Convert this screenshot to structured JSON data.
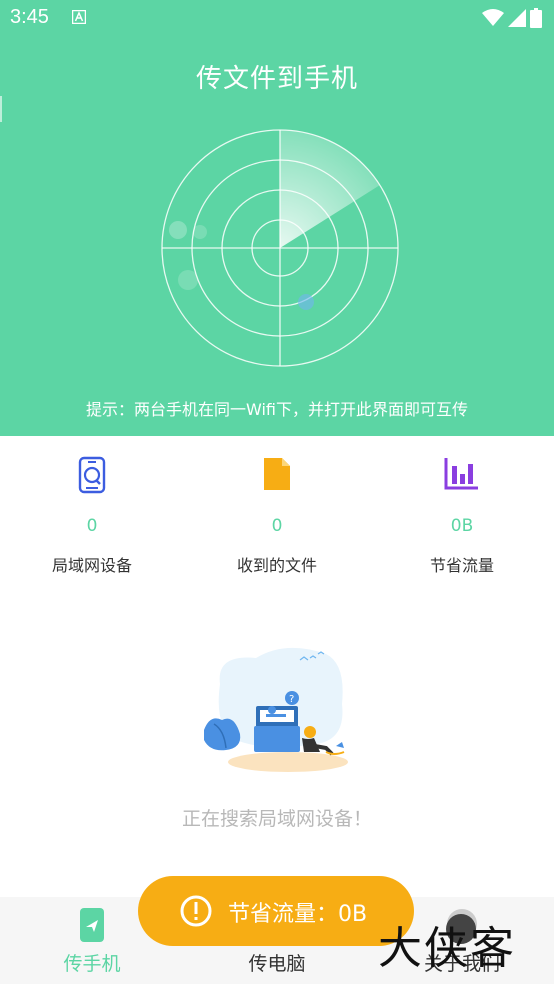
{
  "status_bar": {
    "time": "3:45"
  },
  "header": {
    "title": "传文件到手机",
    "hint": "提示：两台手机在同一Wifi下，并打开此界面即可互传"
  },
  "stats": [
    {
      "value": "0",
      "label": "局域网设备",
      "icon": "phone-search-icon",
      "color": "#3c5de0"
    },
    {
      "value": "0",
      "label": "收到的文件",
      "icon": "file-icon",
      "color": "#f7ad14"
    },
    {
      "value": "0B",
      "label": "节省流量",
      "icon": "bar-chart-icon",
      "color": "#8a3ee0"
    }
  ],
  "empty_state": {
    "text": "正在搜索局域网设备！"
  },
  "bottom_nav": [
    {
      "label": "传手机",
      "icon": "send-phone-icon",
      "active": true
    },
    {
      "label": "传电脑",
      "icon": "computer-icon",
      "active": false
    },
    {
      "label": "关于我们",
      "icon": "about-icon",
      "active": false
    }
  ],
  "toast": {
    "text": "节省流量：0B"
  },
  "watermark": {
    "text": "大侠客"
  },
  "colors": {
    "primary": "#5cd5a4",
    "toast": "#f7ad14",
    "text_gray": "#b8b8b8"
  }
}
